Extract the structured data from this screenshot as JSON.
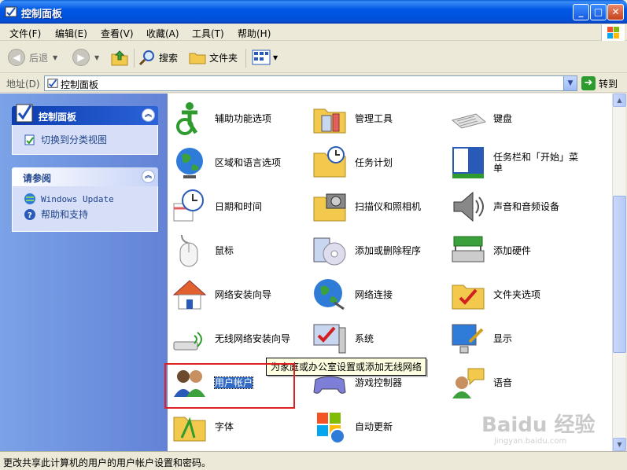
{
  "window": {
    "title": "控制面板"
  },
  "menubar": [
    "文件(F)",
    "编辑(E)",
    "查看(V)",
    "收藏(A)",
    "工具(T)",
    "帮助(H)"
  ],
  "toolbar": {
    "back": "后退",
    "search": "搜索",
    "folders": "文件夹"
  },
  "address": {
    "label": "地址(D)",
    "value": "控制面板",
    "go": "转到"
  },
  "leftpane": {
    "panel1": {
      "title": "控制面板",
      "link": "切换到分类视图"
    },
    "panel2": {
      "title": "请参阅",
      "links": [
        "Windows Update",
        "帮助和支持"
      ]
    }
  },
  "items": [
    "辅助功能选项",
    "管理工具",
    "键盘",
    "区域和语言选项",
    "任务计划",
    "任务栏和「开始」菜单",
    "日期和时间",
    "扫描仪和照相机",
    "声音和音频设备",
    "鼠标",
    "添加或删除程序",
    "添加硬件",
    "网络安装向导",
    "网络连接",
    "文件夹选项",
    "无线网络安装向导",
    "系统",
    "显示",
    "用户帐户",
    "游戏控制器",
    "语音",
    "字体",
    "自动更新"
  ],
  "tooltip": "为家庭或办公室设置或添加无线网络",
  "status": "更改共享此计算机的用户的用户帐户设置和密码。",
  "watermark": {
    "logo": "Baidu 经验",
    "url": "jingyan.baidu.com"
  },
  "colors": {
    "title_blue": "#0058e6",
    "selection": "#316ac5",
    "annotation_red": "#e02020"
  }
}
